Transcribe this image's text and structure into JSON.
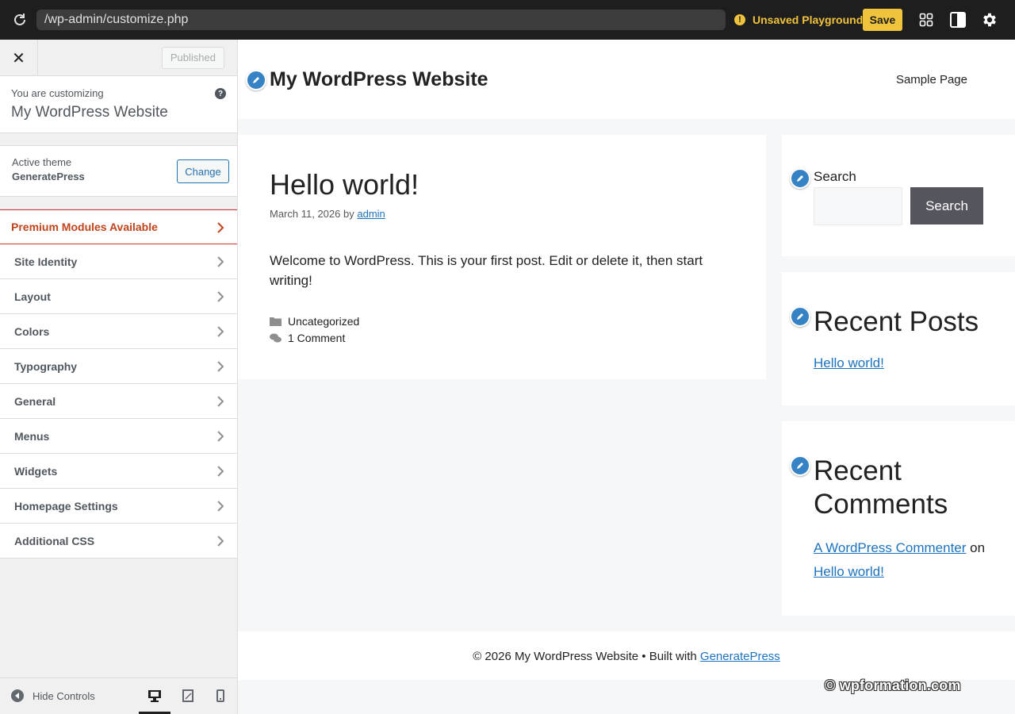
{
  "topbar": {
    "url": "/wp-admin/customize.php",
    "unsaved_label": "Unsaved Playground",
    "save_label": "Save",
    "accent": "#f0c33c"
  },
  "sidebar": {
    "published_label": "Published",
    "customizing_label": "You are customizing",
    "site_name": "My WordPress Website",
    "help_glyph": "?",
    "theme_label": "Active theme",
    "theme_name": "GeneratePress",
    "change_label": "Change",
    "premium_label": "Premium Modules Available",
    "sections": [
      "Site Identity",
      "Layout",
      "Colors",
      "Typography",
      "General",
      "Menus",
      "Widgets",
      "Homepage Settings",
      "Additional CSS"
    ],
    "hide_controls_label": "Hide Controls"
  },
  "preview": {
    "site_title": "My WordPress Website",
    "nav_link": "Sample Page",
    "post": {
      "title": "Hello world!",
      "date": "March 11, 2026",
      "by": "by",
      "author": "admin",
      "body": "Welcome to WordPress. This is your first post. Edit or delete it, then start writing!",
      "category": "Uncategorized",
      "comments": "1 Comment"
    },
    "search_widget": {
      "label": "Search",
      "button": "Search"
    },
    "recent_posts": {
      "heading": "Recent Posts",
      "item": "Hello world!"
    },
    "recent_comments": {
      "heading": "Recent Comments",
      "author": "A WordPress Commenter",
      "on": "on",
      "post": "Hello world!"
    },
    "footer": {
      "text": "© 2026 My WordPress Website • Built with",
      "link": "GeneratePress"
    }
  },
  "watermark": "© wpformation.com",
  "colors": {
    "link": "#1e73be",
    "premium": "#c0441c",
    "edit_pencil": "#3582c4"
  }
}
